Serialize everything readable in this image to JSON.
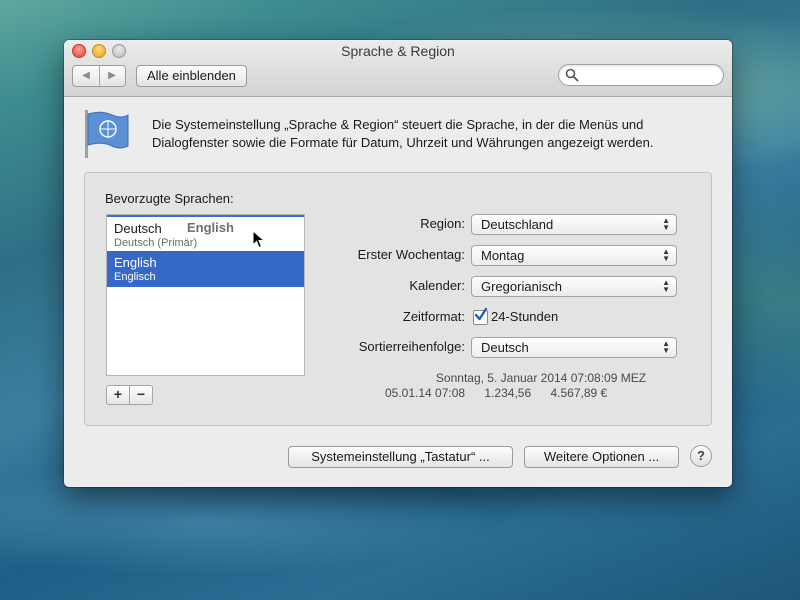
{
  "window": {
    "title": "Sprache & Region",
    "show_all_label": "Alle einblenden",
    "search": {
      "placeholder": "",
      "icon": "magnifier-icon"
    }
  },
  "intro": {
    "icon": "un-flag-icon",
    "text": "Die Systemeinstellung „Sprache & Region“ steuert die Sprache, in der die Menüs und Dialogfenster sowie die Formate für Datum, Uhrzeit und Währungen angezeigt werden."
  },
  "languages": {
    "heading": "Bevorzugte Sprachen:",
    "items": [
      {
        "name": "Deutsch",
        "sub": "Deutsch (Primär)",
        "selected": false
      },
      {
        "name": "English",
        "sub": "Englisch",
        "selected": true
      }
    ],
    "drag_ghost": "English",
    "add_label": "+",
    "remove_label": "−"
  },
  "settings": {
    "region": {
      "label": "Region:",
      "value": "Deutschland"
    },
    "first_weekday": {
      "label": "Erster Wochentag:",
      "value": "Montag"
    },
    "calendar": {
      "label": "Kalender:",
      "value": "Gregorianisch"
    },
    "time_format": {
      "label": "Zeitformat:",
      "checkbox_label": "24-Stunden",
      "checked": true
    },
    "sort_order": {
      "label": "Sortierreihenfolge:",
      "value": "Deutsch"
    }
  },
  "sample": {
    "date_long": "Sonntag, 5. Januar 2014 07:08:09 MEZ",
    "date_short": "05.01.14 07:08",
    "number": "1.234,56",
    "currency": "4.567,89 €"
  },
  "buttons": {
    "keyboard": "Systemeinstellung „Tastatur“ ...",
    "more_options": "Weitere Optionen ...",
    "help": "?"
  },
  "colors": {
    "selection": "#3668c8",
    "window_bg": "#ececec"
  }
}
